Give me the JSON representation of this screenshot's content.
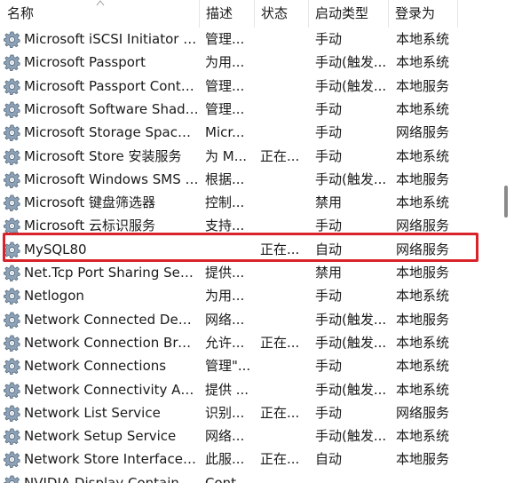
{
  "columns": {
    "name": "名称",
    "description": "描述",
    "status": "状态",
    "startup_type": "启动类型",
    "logon_as": "登录为"
  },
  "services": [
    {
      "name": "Microsoft iSCSI Initiator Ser...",
      "description": "管理...",
      "status": "",
      "startup_type": "手动",
      "logon_as": "本地系统"
    },
    {
      "name": "Microsoft Passport",
      "description": "为用...",
      "status": "",
      "startup_type": "手动(触发...",
      "logon_as": "本地系统"
    },
    {
      "name": "Microsoft Passport Container",
      "description": "管理...",
      "status": "",
      "startup_type": "手动(触发...",
      "logon_as": "本地服务"
    },
    {
      "name": "Microsoft Software Shado...",
      "description": "管理...",
      "status": "",
      "startup_type": "手动",
      "logon_as": "本地系统"
    },
    {
      "name": "Microsoft Storage Spaces S...",
      "description": "Micr...",
      "status": "",
      "startup_type": "手动",
      "logon_as": "网络服务"
    },
    {
      "name": "Microsoft Store 安装服务",
      "description": "为 M...",
      "status": "正在...",
      "startup_type": "手动",
      "logon_as": "本地系统"
    },
    {
      "name": "Microsoft Windows SMS 路...",
      "description": "根据...",
      "status": "",
      "startup_type": "手动(触发...",
      "logon_as": "本地服务"
    },
    {
      "name": "Microsoft 键盘筛选器",
      "description": "控制...",
      "status": "",
      "startup_type": "禁用",
      "logon_as": "本地系统"
    },
    {
      "name": "Microsoft 云标识服务",
      "description": "支持...",
      "status": "",
      "startup_type": "手动",
      "logon_as": "网络服务"
    },
    {
      "name": "MySQL80",
      "description": "",
      "status": "正在...",
      "startup_type": "自动",
      "logon_as": "网络服务"
    },
    {
      "name": "Net.Tcp Port Sharing Service",
      "description": "提供...",
      "status": "",
      "startup_type": "禁用",
      "logon_as": "本地服务"
    },
    {
      "name": "Netlogon",
      "description": "为用...",
      "status": "",
      "startup_type": "手动",
      "logon_as": "本地系统"
    },
    {
      "name": "Network Connected Devic...",
      "description": "网络...",
      "status": "",
      "startup_type": "手动(触发...",
      "logon_as": "本地服务"
    },
    {
      "name": "Network Connection Broker",
      "description": "允许...",
      "status": "正在...",
      "startup_type": "手动(触发...",
      "logon_as": "本地系统"
    },
    {
      "name": "Network Connections",
      "description": "管理\"...",
      "status": "",
      "startup_type": "手动",
      "logon_as": "本地系统"
    },
    {
      "name": "Network Connectivity Assis...",
      "description": "提供 ...",
      "status": "",
      "startup_type": "手动(触发...",
      "logon_as": "本地系统"
    },
    {
      "name": "Network List Service",
      "description": "识别...",
      "status": "正在...",
      "startup_type": "手动",
      "logon_as": "网络服务"
    },
    {
      "name": "Network Setup Service",
      "description": "网络...",
      "status": "",
      "startup_type": "手动(触发...",
      "logon_as": "本地系统"
    },
    {
      "name": "Network Store Interface Se...",
      "description": "此服...",
      "status": "正在...",
      "startup_type": "自动",
      "logon_as": "本地服务"
    },
    {
      "name": "NVIDIA Display Container LS",
      "description": "Cont...",
      "status": "",
      "startup_type": "",
      "logon_as": ""
    }
  ],
  "highlighted_service": "MySQL80",
  "row_icon": "gear-service-icon",
  "colors": {
    "highlight_border": "#d8232a",
    "header_separator": "#e5e5e5",
    "scroll_thumb": "#8a8a8a"
  }
}
